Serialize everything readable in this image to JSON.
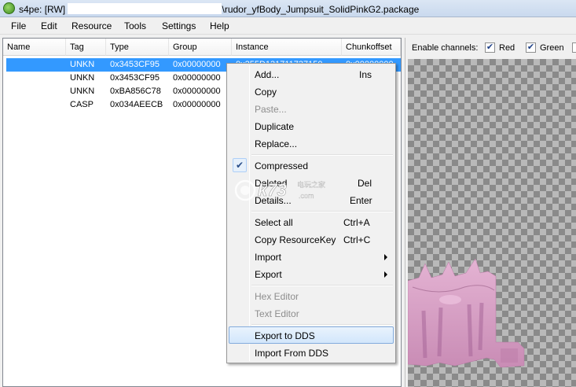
{
  "window": {
    "title_prefix": "s4pe: [RW]",
    "title_suffix": "\\rudor_yfBody_Jumpsuit_SolidPinkG2.package"
  },
  "menubar": {
    "items": [
      "File",
      "Edit",
      "Resource",
      "Tools",
      "Settings",
      "Help"
    ]
  },
  "resource_list": {
    "columns": [
      "Name",
      "Tag",
      "Type",
      "Group",
      "Instance",
      "Chunkoffset"
    ],
    "rows": [
      {
        "name": "",
        "tag": "UNKN",
        "type": "0x3453CF95",
        "group": "0x00000000",
        "instance": "0x255D131711737150",
        "chunkoffset": "0x00000000",
        "selected": true
      },
      {
        "name": "",
        "tag": "UNKN",
        "type": "0x3453CF95",
        "group": "0x00000000",
        "instance": "",
        "chunkoffset": "",
        "selected": false
      },
      {
        "name": "",
        "tag": "UNKN",
        "type": "0xBA856C78",
        "group": "0x00000000",
        "instance": "",
        "chunkoffset": "",
        "selected": false
      },
      {
        "name": "",
        "tag": "CASP",
        "type": "0x034AEECB",
        "group": "0x00000000",
        "instance": "",
        "chunkoffset": "",
        "selected": false
      }
    ]
  },
  "preview": {
    "channels_label": "Enable channels:",
    "channels": [
      {
        "label": "Red",
        "checked": true
      },
      {
        "label": "Green",
        "checked": true
      }
    ],
    "garment_color": "#d9a3c6"
  },
  "context_menu": {
    "items": [
      {
        "label": "Add...",
        "shortcut": "Ins"
      },
      {
        "label": "Copy",
        "shortcut": ""
      },
      {
        "label": "Paste...",
        "shortcut": "",
        "disabled": true
      },
      {
        "label": "Duplicate",
        "shortcut": ""
      },
      {
        "label": "Replace...",
        "shortcut": ""
      },
      {
        "label": "Compressed",
        "shortcut": "",
        "checked": true
      },
      {
        "label": "Deleted",
        "shortcut": "Del"
      },
      {
        "label": "Details...",
        "shortcut": "Enter"
      },
      {
        "label": "Select all",
        "shortcut": "Ctrl+A"
      },
      {
        "label": "Copy ResourceKey",
        "shortcut": "Ctrl+C"
      },
      {
        "label": "Import",
        "submenu": true
      },
      {
        "label": "Export",
        "submenu": true
      },
      {
        "label": "Hex Editor",
        "disabled": true
      },
      {
        "label": "Text Editor",
        "disabled": true
      },
      {
        "label": "Export to DDS",
        "highlighted": true
      },
      {
        "label": "Import From DDS"
      }
    ]
  },
  "watermark": {
    "brand": "k73",
    "tagline": "电玩之家",
    "domain": ".com"
  },
  "colors": {
    "selection": "#3399ff",
    "menu_hover_border": "#84acdd",
    "checker_light": "#b9b9b9",
    "checker_dark": "#8a8a8a"
  }
}
